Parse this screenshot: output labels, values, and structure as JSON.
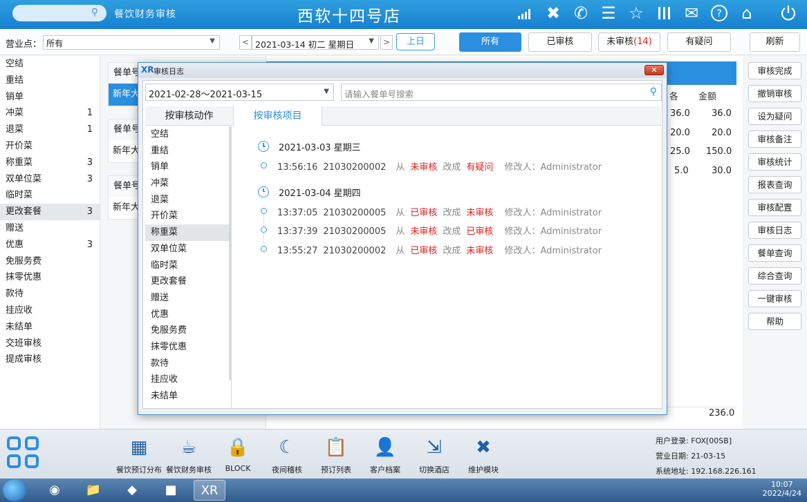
{
  "topbar": {
    "app_title": "餐饮财务审核",
    "store_name": "西软十四号店",
    "icons": [
      "signal-icon",
      "tools-icon",
      "phone-icon",
      "menu-icon",
      "star-icon",
      "columns-icon",
      "mail-icon",
      "help-icon",
      "home-icon",
      "power-icon"
    ]
  },
  "filterbar": {
    "outlet_label": "营业点：",
    "outlet_value": "所有",
    "date_value": "2021-03-14  初二  星期日",
    "prev_day": "上日",
    "buttons": {
      "all": "所有",
      "audited": "已审核",
      "unaudited": "未审核",
      "unaudited_count": "(14)",
      "doubtful": "有疑问",
      "refresh": "刷新"
    }
  },
  "sidebar": {
    "items": [
      {
        "label": "空结",
        "count": ""
      },
      {
        "label": "重结",
        "count": ""
      },
      {
        "label": "销单",
        "count": ""
      },
      {
        "label": "冲菜",
        "count": "1"
      },
      {
        "label": "退菜",
        "count": "1"
      },
      {
        "label": "开价菜",
        "count": ""
      },
      {
        "label": "称重菜",
        "count": "3"
      },
      {
        "label": "双单位菜",
        "count": "3"
      },
      {
        "label": "临时菜",
        "count": ""
      },
      {
        "label": "更改套餐",
        "count": "3"
      },
      {
        "label": "赠送",
        "count": ""
      },
      {
        "label": "优惠",
        "count": "3"
      },
      {
        "label": "免服务费",
        "count": ""
      },
      {
        "label": "抹零优惠",
        "count": ""
      },
      {
        "label": "款待",
        "count": ""
      },
      {
        "label": "挂应收",
        "count": ""
      },
      {
        "label": "未结单",
        "count": ""
      },
      {
        "label": "交班审核",
        "count": ""
      },
      {
        "label": "提成审核",
        "count": ""
      }
    ]
  },
  "orders": {
    "cards": [
      {
        "head": "餐单号",
        "body": "新年大"
      },
      {
        "head": "餐单号",
        "body": "新年大"
      },
      {
        "head": "餐单号",
        "body": "新年大"
      }
    ]
  },
  "detail": {
    "col_partial": "各",
    "col_amount": "金额",
    "rows": [
      {
        "a": "36.0",
        "b": "36.0"
      },
      {
        "a": "20.0",
        "b": "20.0"
      },
      {
        "a": "25.0",
        "b": "150.0"
      },
      {
        "a": "5.0",
        "b": "30.0"
      }
    ],
    "grand_total": "236.0"
  },
  "actions": [
    "审核完成",
    "撤销审核",
    "设为疑问",
    "审核备注",
    "审核统计",
    "报表查询",
    "审核配置",
    "审核日志",
    "餐单查询",
    "综合查询",
    "一键审核",
    "帮助"
  ],
  "modal": {
    "title": "审核日志",
    "logo": "XR",
    "close": "✕",
    "range": "2021-02-28～2021-03-15",
    "search_placeholder": "请输入餐单号搜索",
    "tab_action": "按审核动作",
    "tab_item": "按审核项目",
    "action_list": [
      "空结",
      "重结",
      "销单",
      "冲菜",
      "退菜",
      "开价菜",
      "称重菜",
      "双单位菜",
      "临时菜",
      "更改套餐",
      "赠送",
      "优惠",
      "免服务费",
      "抹零优惠",
      "款待",
      "挂应收",
      "未结单"
    ],
    "groups": [
      {
        "date": "2021-03-03    星期三",
        "entries": [
          {
            "time": "13:56:16",
            "order": "21030200002",
            "from_word": "从",
            "from": "未审核",
            "change_word": "改成",
            "to": "有疑问",
            "modifier": "修改人：Administrator"
          }
        ]
      },
      {
        "date": "2021-03-04    星期四",
        "entries": [
          {
            "time": "13:37:05",
            "order": "21030200005",
            "from_word": "从",
            "from": "已审核",
            "change_word": "改成",
            "to": "未审核",
            "modifier": "修改人：Administrator"
          },
          {
            "time": "13:37:39",
            "order": "21030200005",
            "from_word": "从",
            "from": "未审核",
            "change_word": "改成",
            "to": "已审核",
            "modifier": "修改人：Administrator"
          },
          {
            "time": "13:55:27",
            "order": "21030200002",
            "from_word": "从",
            "from": "已审核",
            "change_word": "改成",
            "to": "未审核",
            "modifier": "修改人：Administrator"
          }
        ]
      }
    ]
  },
  "dock": {
    "items": [
      {
        "label": "餐饮预订分布",
        "icon": "calendar-grid-icon"
      },
      {
        "label": "餐饮财务审核",
        "icon": "coffee-cup-icon"
      },
      {
        "label": "BLOCK",
        "icon": "lock-icon"
      },
      {
        "label": "夜间稽核",
        "icon": "moon-icon"
      },
      {
        "label": "预订列表",
        "icon": "clipboard-icon"
      },
      {
        "label": "客户档案",
        "icon": "profile-icon"
      },
      {
        "label": "切换酒店",
        "icon": "switch-icon"
      },
      {
        "label": "维护模块",
        "icon": "wrench-icon"
      }
    ],
    "user_login": "用户登录: FOX[00SB]",
    "business_date": "营业日期: 21-03-15",
    "system_address": "系统地址: 192.168.226.161"
  },
  "taskbar": {
    "time": "10:07",
    "date": "2022/4/24"
  }
}
